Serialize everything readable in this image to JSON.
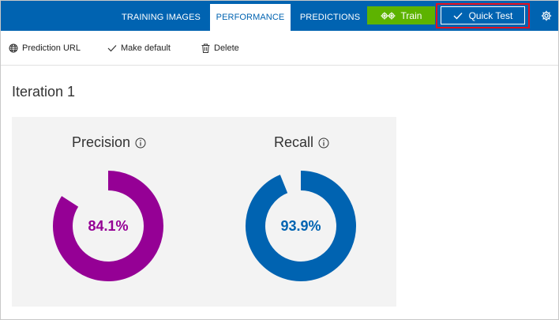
{
  "nav": {
    "tabs": [
      {
        "label": "TRAINING IMAGES",
        "active": false
      },
      {
        "label": "PERFORMANCE",
        "active": true
      },
      {
        "label": "PREDICTIONS",
        "active": false
      }
    ],
    "train_label": "Train",
    "quick_test_label": "Quick Test",
    "settings_icon": "gear-icon",
    "colors": {
      "bar": "#0063b1",
      "train": "#5db300",
      "highlight": "#e3101f"
    }
  },
  "toolbar": {
    "prediction_url_label": "Prediction URL",
    "make_default_label": "Make default",
    "delete_label": "Delete"
  },
  "iteration": {
    "title": "Iteration 1"
  },
  "metrics": {
    "precision": {
      "label": "Precision",
      "value_text": "84.1%",
      "value": 0.841,
      "color": "#950095"
    },
    "recall": {
      "label": "Recall",
      "value_text": "93.9%",
      "value": 0.939,
      "color": "#0063b1"
    }
  }
}
